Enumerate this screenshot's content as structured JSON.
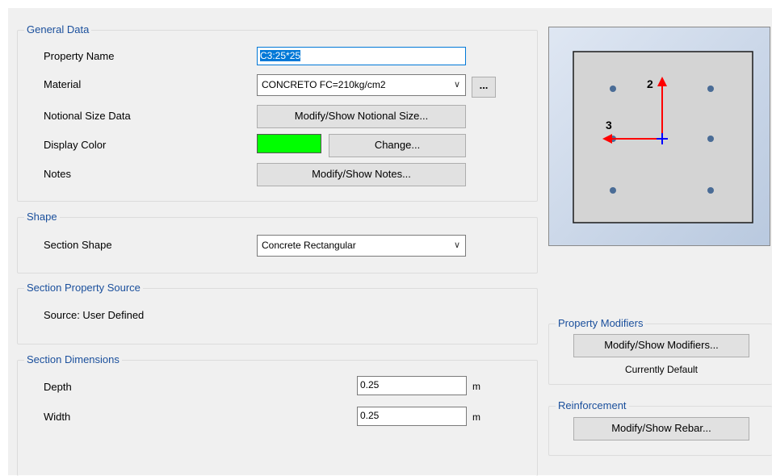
{
  "general": {
    "title": "General Data",
    "property_name_label": "Property Name",
    "property_name_value": "C3:25*25",
    "material_label": "Material",
    "material_value": "CONCRETO FC=210kg/cm2",
    "material_more": "...",
    "notional_label": "Notional Size Data",
    "notional_button": "Modify/Show Notional Size...",
    "color_label": "Display Color",
    "color_value": "#00ff00",
    "change_button": "Change...",
    "notes_label": "Notes",
    "notes_button": "Modify/Show Notes..."
  },
  "shape": {
    "title": "Shape",
    "section_shape_label": "Section Shape",
    "section_shape_value": "Concrete Rectangular"
  },
  "source": {
    "title": "Section Property Source",
    "source_text": "Source:  User Defined"
  },
  "dimensions": {
    "title": "Section Dimensions",
    "depth_label": "Depth",
    "depth_value": "0.25",
    "width_label": "Width",
    "width_value": "0.25",
    "unit": "m"
  },
  "preview": {
    "axis2": "2",
    "axis3": "3"
  },
  "modifiers": {
    "title": "Property Modifiers",
    "button": "Modify/Show Modifiers...",
    "status": "Currently Default"
  },
  "reinforcement": {
    "title": "Reinforcement",
    "button": "Modify/Show Rebar..."
  }
}
